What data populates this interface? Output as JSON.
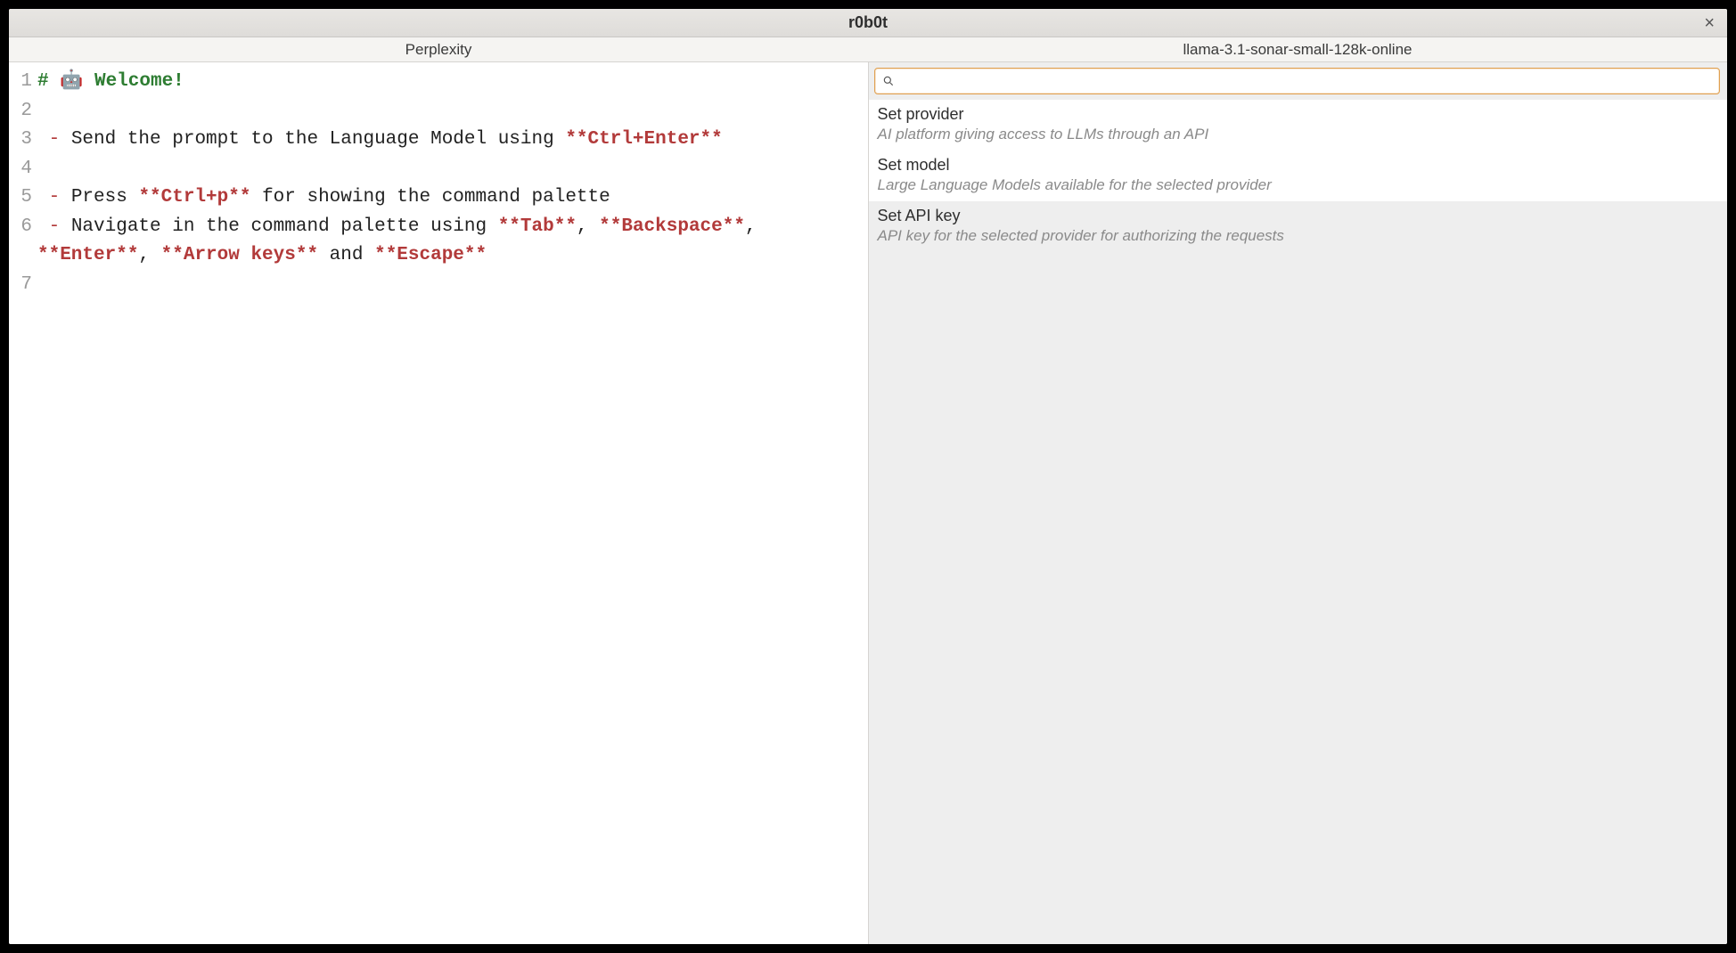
{
  "window": {
    "title": "r0b0t",
    "close_label": "×"
  },
  "subheader": {
    "left": "Perplexity",
    "right": "llama-3.1-sonar-small-128k-online"
  },
  "editor": {
    "lines": [
      {
        "n": "1",
        "segments": [
          {
            "cls": "hl-hash",
            "t": "# "
          },
          {
            "cls": "hl-text",
            "t": "🤖 "
          },
          {
            "cls": "hl-head",
            "t": "Welcome!"
          }
        ]
      },
      {
        "n": "2",
        "segments": []
      },
      {
        "n": "3",
        "segments": [
          {
            "cls": "hl-text",
            "t": " "
          },
          {
            "cls": "hl-dash",
            "t": "-"
          },
          {
            "cls": "hl-text",
            "t": " Send the prompt to the Language Model using "
          },
          {
            "cls": "hl-bold",
            "t": "**Ctrl+Enter**"
          }
        ]
      },
      {
        "n": "4",
        "segments": []
      },
      {
        "n": "5",
        "segments": [
          {
            "cls": "hl-text",
            "t": " "
          },
          {
            "cls": "hl-dash",
            "t": "-"
          },
          {
            "cls": "hl-text",
            "t": " Press "
          },
          {
            "cls": "hl-bold",
            "t": "**Ctrl+p**"
          },
          {
            "cls": "hl-text",
            "t": " for showing the command palette"
          }
        ]
      },
      {
        "n": "6",
        "segments": [
          {
            "cls": "hl-text",
            "t": " "
          },
          {
            "cls": "hl-dash",
            "t": "-"
          },
          {
            "cls": "hl-text",
            "t": " Navigate in the command palette using "
          },
          {
            "cls": "hl-bold",
            "t": "**Tab**"
          },
          {
            "cls": "hl-text",
            "t": ", "
          },
          {
            "cls": "hl-bold",
            "t": "**Backspace**"
          },
          {
            "cls": "hl-text",
            "t": ", "
          },
          {
            "cls": "hl-bold",
            "t": "**Enter**"
          },
          {
            "cls": "hl-text",
            "t": ", "
          },
          {
            "cls": "hl-bold",
            "t": "**Arrow keys**"
          },
          {
            "cls": "hl-text",
            "t": " and "
          },
          {
            "cls": "hl-bold",
            "t": "**Escape**"
          }
        ]
      },
      {
        "n": "7",
        "segments": []
      }
    ]
  },
  "palette": {
    "search_value": "",
    "items": [
      {
        "title": "Set provider",
        "desc": "AI platform giving access to LLMs through an API",
        "selected": false
      },
      {
        "title": "Set model",
        "desc": "Large Language Models available for the selected provider",
        "selected": false
      },
      {
        "title": "Set API key",
        "desc": "API key for the selected provider for authorizing the requests",
        "selected": true
      }
    ]
  }
}
